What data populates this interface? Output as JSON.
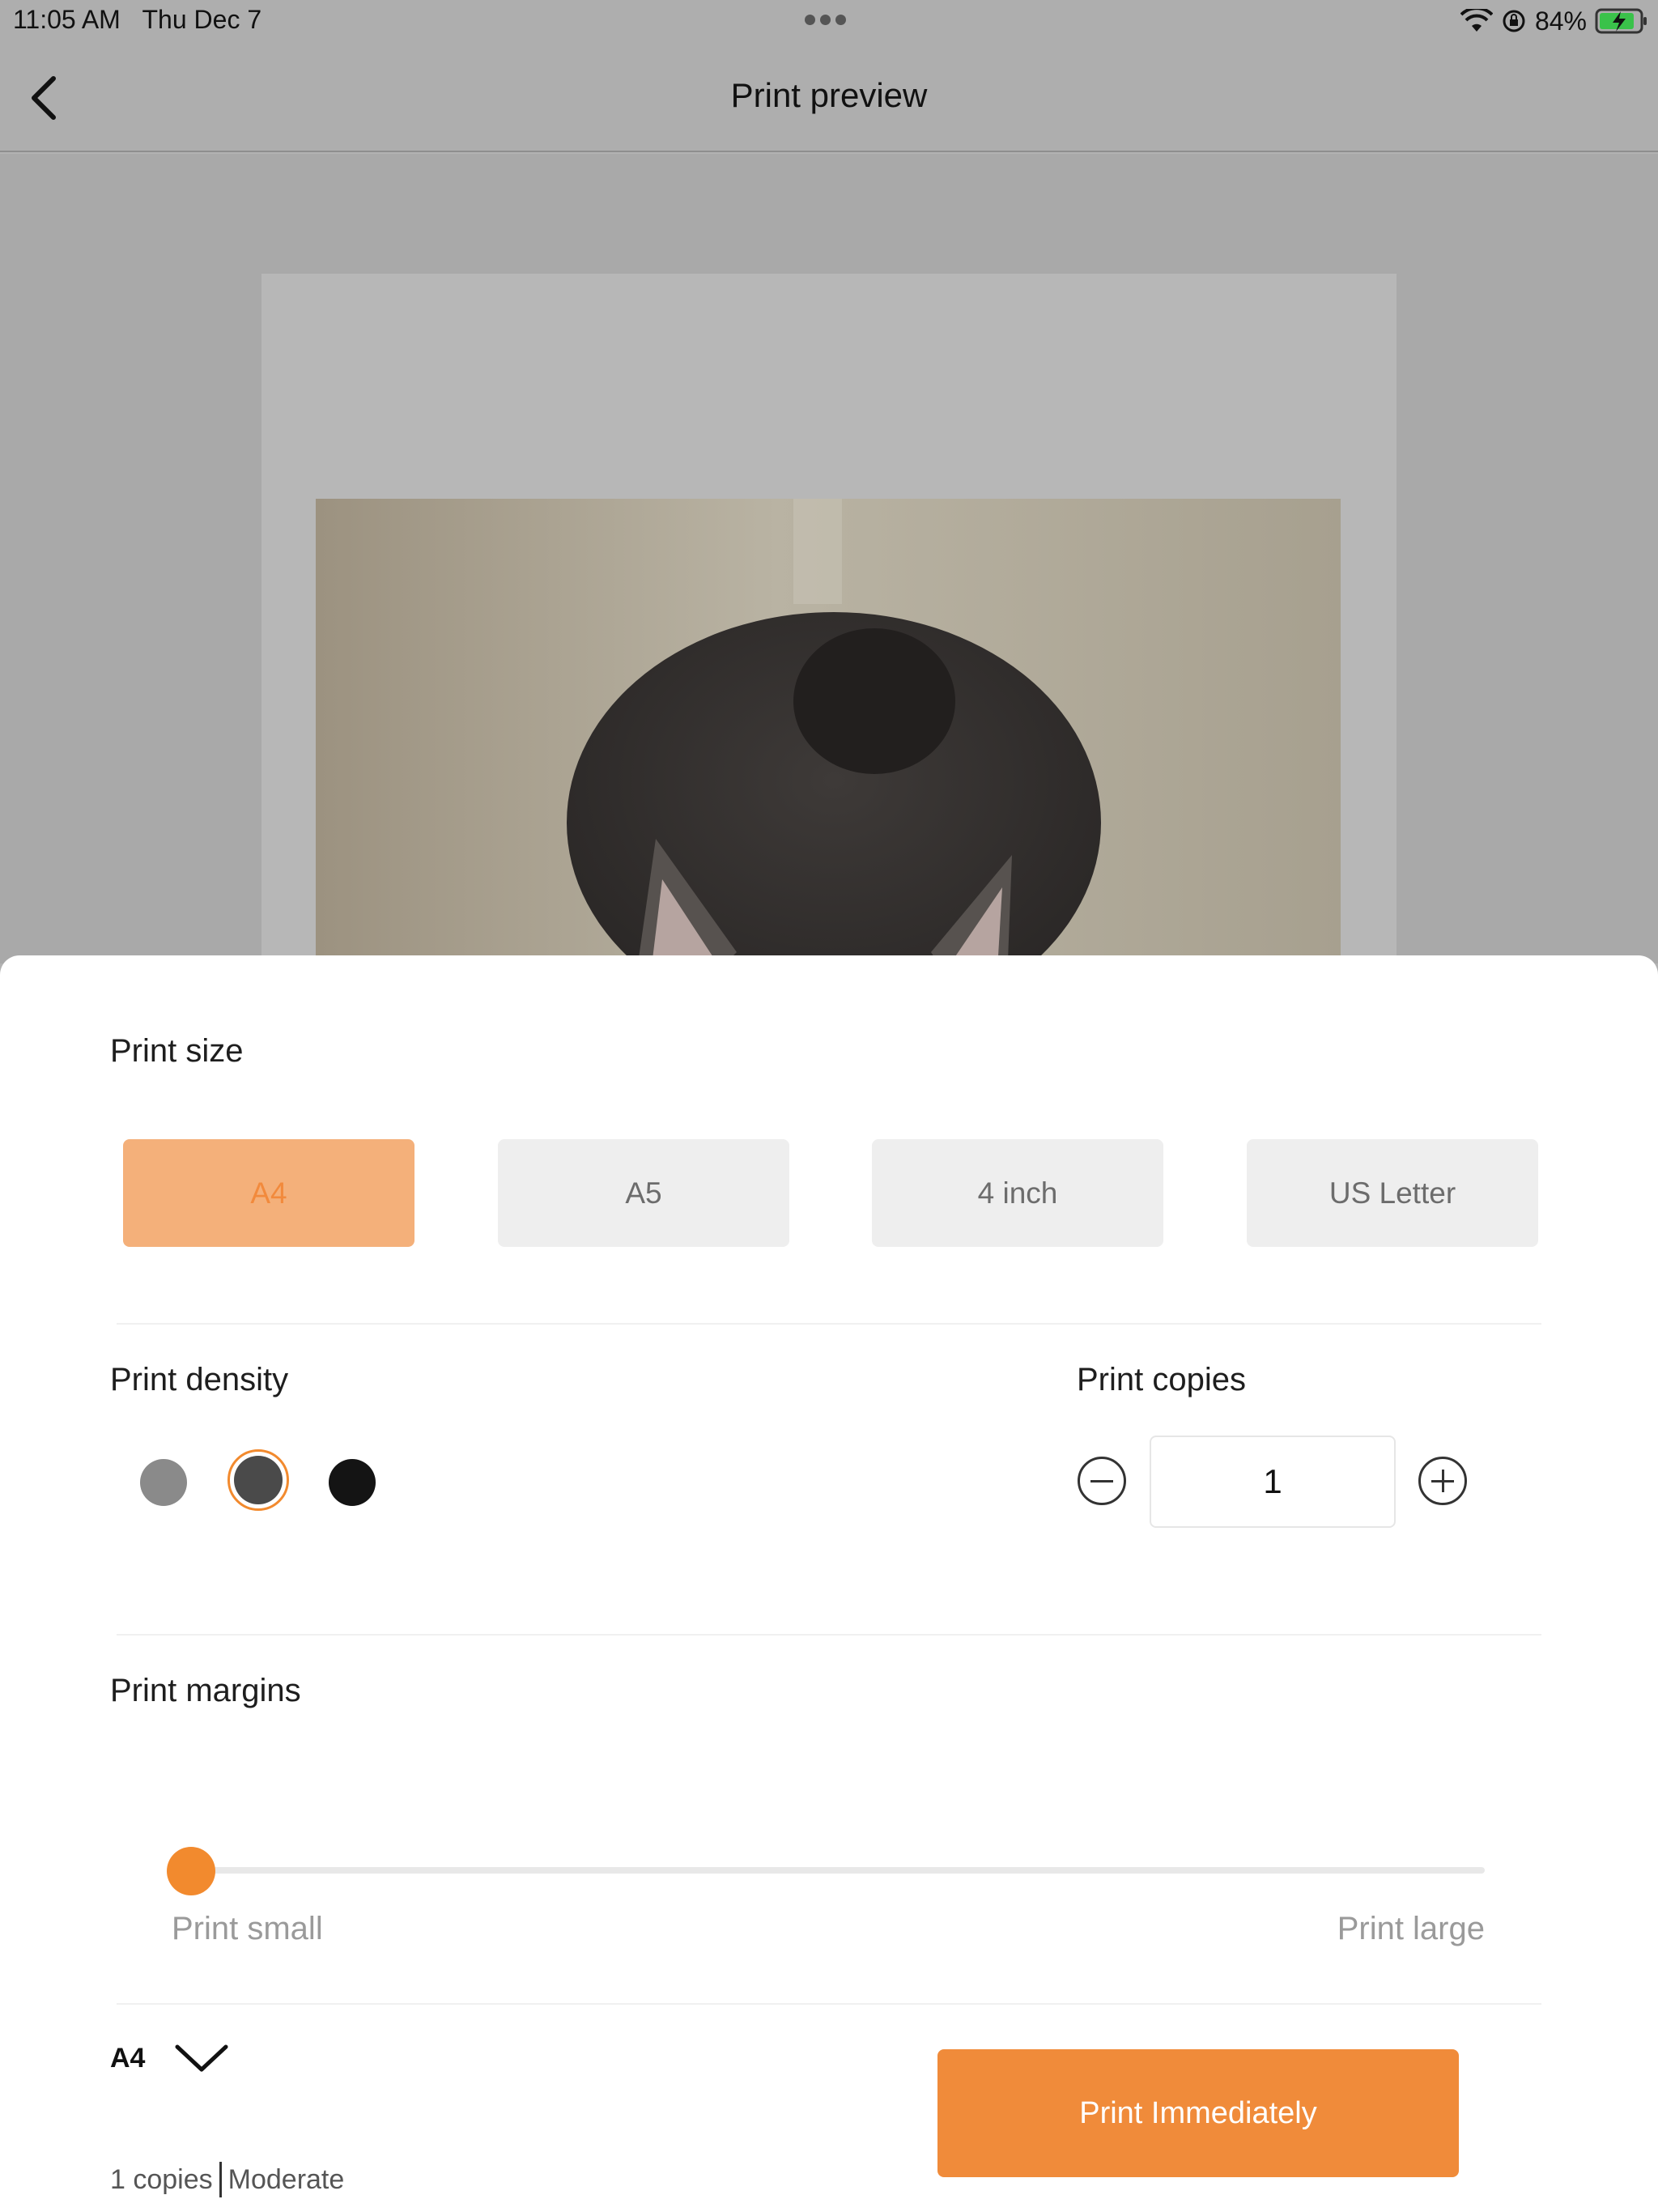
{
  "status_bar": {
    "time": "11:05 AM",
    "date": "Thu Dec 7",
    "battery": "84%",
    "icons": [
      "wifi-icon",
      "orientation-lock-icon",
      "battery-charging-icon"
    ]
  },
  "nav": {
    "title": "Print preview",
    "back_icon": "chevron-left-icon"
  },
  "print_size": {
    "title": "Print size",
    "options": [
      "A4",
      "A5",
      "4 inch",
      "US Letter"
    ],
    "selected": "A4"
  },
  "print_density": {
    "title": "Print density",
    "levels": [
      {
        "name": "light",
        "color": "#8a8a8a"
      },
      {
        "name": "moderate",
        "color": "#4a4a4a"
      },
      {
        "name": "dark",
        "color": "#141414"
      }
    ],
    "selected": "moderate"
  },
  "print_copies": {
    "title": "Print copies",
    "value": "1"
  },
  "print_margins": {
    "title": "Print margins",
    "min_label": "Print small",
    "max_label": "Print large",
    "value_fraction": 0
  },
  "footer": {
    "size_label": "A4",
    "summary_copies": "1 copies",
    "summary_density": "Moderate",
    "print_button": "Print Immediately"
  },
  "colors": {
    "accent": "#f08b3a",
    "selected_bg": "#f4b07a"
  }
}
